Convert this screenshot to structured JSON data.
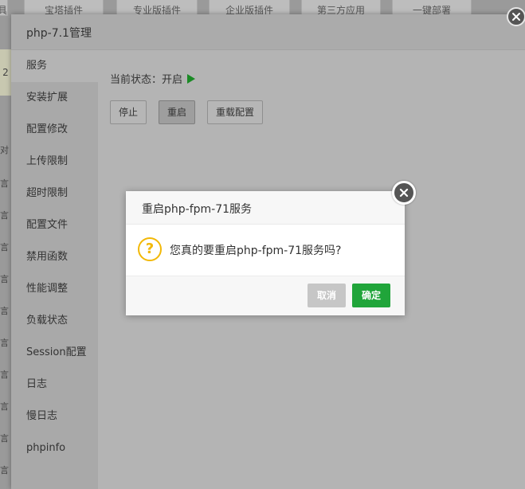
{
  "background": {
    "tabs": [
      "具",
      "宝塔插件",
      "专业版插件",
      "企业版插件",
      "第三方应用",
      "一键部署"
    ],
    "left_number": "2",
    "left_rows": [
      "对",
      "言",
      "言",
      "言",
      "言",
      "言",
      "言",
      "言",
      "言",
      "言",
      "言",
      "言"
    ]
  },
  "panel": {
    "title": "php-7.1管理",
    "sidebar": [
      {
        "label": "服务"
      },
      {
        "label": "安装扩展"
      },
      {
        "label": "配置修改"
      },
      {
        "label": "上传限制"
      },
      {
        "label": "超时限制"
      },
      {
        "label": "配置文件"
      },
      {
        "label": "禁用函数"
      },
      {
        "label": "性能调整"
      },
      {
        "label": "负载状态"
      },
      {
        "label": "Session配置"
      },
      {
        "label": "日志"
      },
      {
        "label": "慢日志"
      },
      {
        "label": "phpinfo"
      }
    ],
    "status_label": "当前状态：",
    "status_value": "开启",
    "buttons": {
      "stop": "停止",
      "restart": "重启",
      "reload": "重载配置"
    }
  },
  "modal": {
    "title": "重启php-fpm-71服务",
    "message": "您真的要重启php-fpm-71服务吗?",
    "icon_glyph": "?",
    "cancel": "取消",
    "confirm": "确定",
    "accent_color": "#20a53a",
    "warning_color": "#f2b807"
  }
}
